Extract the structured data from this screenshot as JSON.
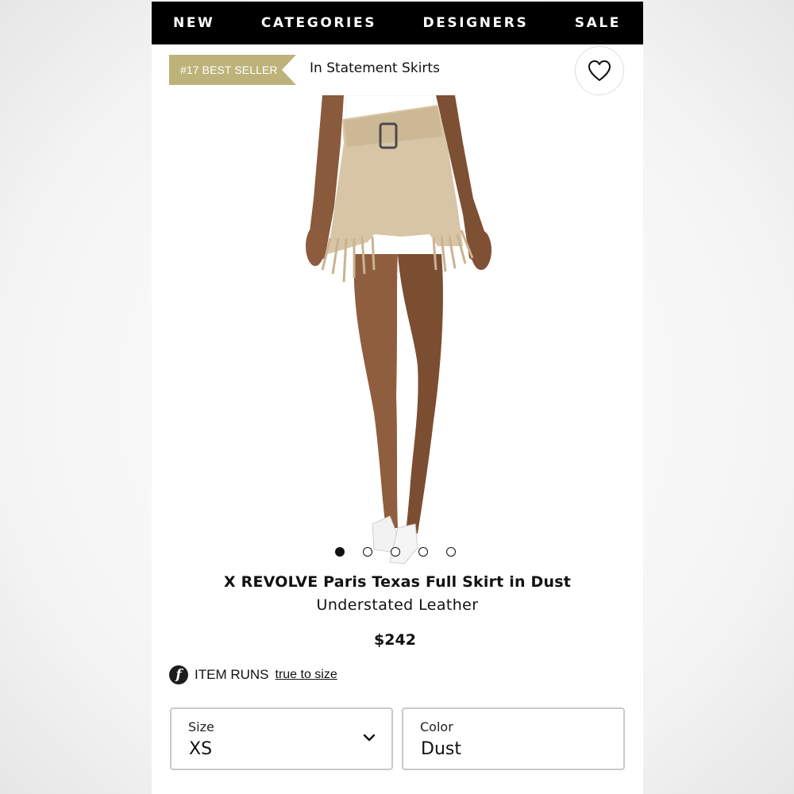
{
  "nav": {
    "items": [
      {
        "label": "NEW"
      },
      {
        "label": "CATEGORIES"
      },
      {
        "label": "DESIGNERS"
      },
      {
        "label": "SALE"
      }
    ]
  },
  "badge": {
    "label": "#17 BEST SELLER",
    "color": "#bdb27a"
  },
  "category": {
    "label": "In Statement Skirts"
  },
  "wishlist": {
    "icon": "heart-outline-icon"
  },
  "carousel": {
    "total": 5,
    "active_index": 0
  },
  "product": {
    "title": "X REVOLVE Paris Texas Full Skirt in Dust",
    "brand": "Understated Leather",
    "price": "$242"
  },
  "fit": {
    "icon": "fit-predictor-icon",
    "icon_letter": "f",
    "label": "ITEM RUNS",
    "value": "true to size"
  },
  "size_select": {
    "label": "Size",
    "value": "XS"
  },
  "color_select": {
    "label": "Color",
    "value": "Dust"
  }
}
